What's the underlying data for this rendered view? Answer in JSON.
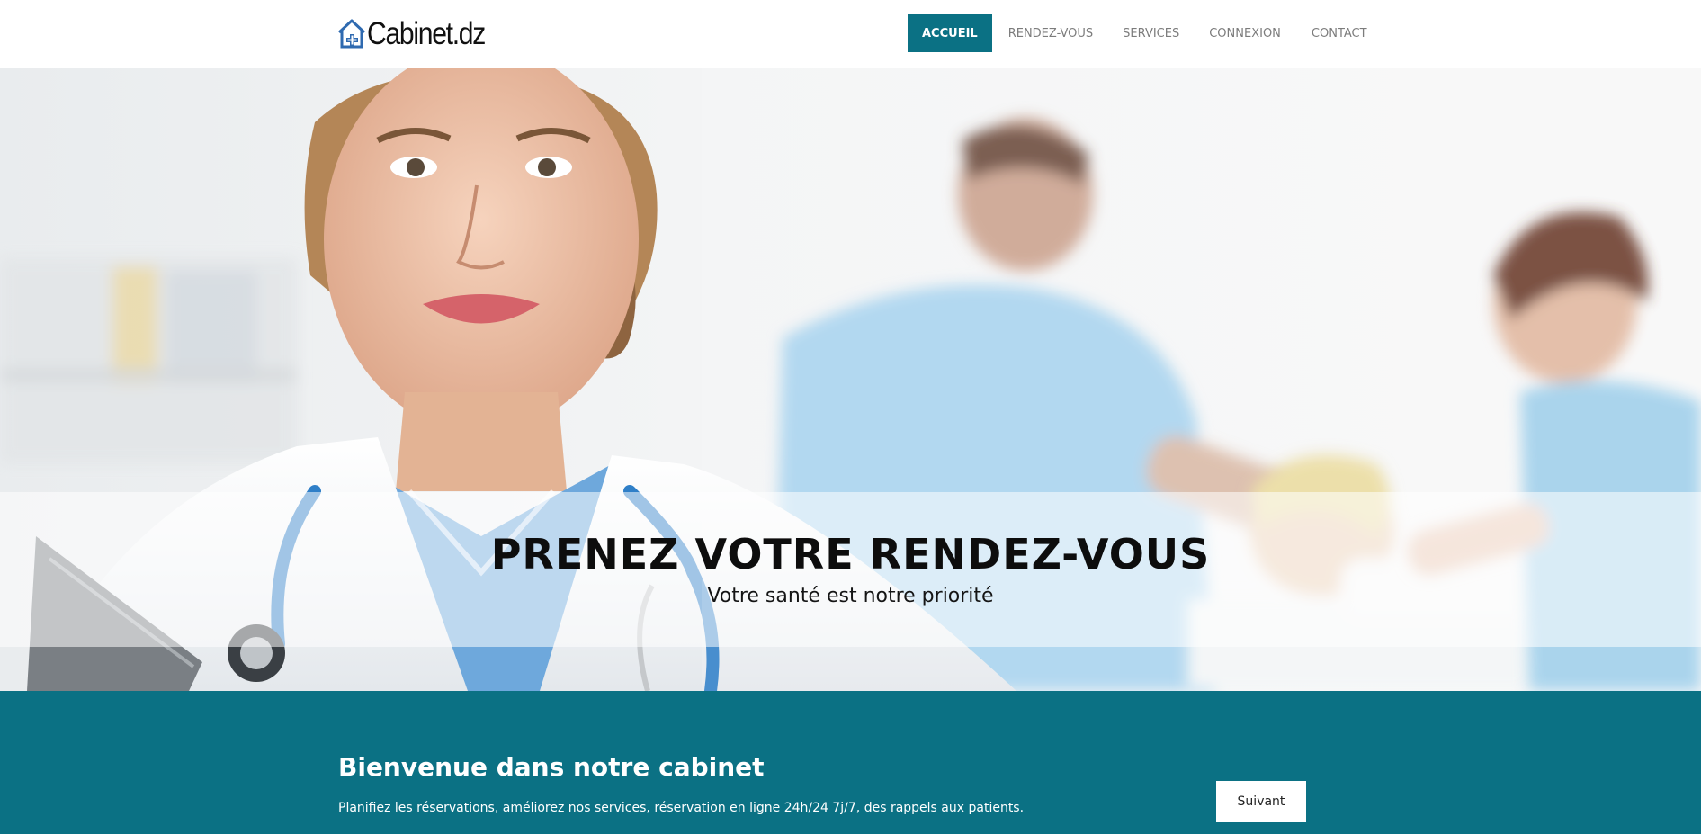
{
  "header": {
    "logo_text": "Cabinet.dz",
    "logo_icon": "house-medical-cross-icon",
    "nav": [
      {
        "label": "ACCUEIL",
        "active": true
      },
      {
        "label": "RENDEZ-VOUS",
        "active": false
      },
      {
        "label": "SERVICES",
        "active": false
      },
      {
        "label": "CONNEXION",
        "active": false
      },
      {
        "label": "CONTACT",
        "active": false
      }
    ]
  },
  "hero": {
    "title": "PRENEZ VOTRE RENDEZ-VOUS",
    "subtitle": "Votre santé est notre priorité"
  },
  "welcome": {
    "title": "Bienvenue dans notre cabinet",
    "text": "Planifiez les réservations, améliorez nos services, réservation en ligne 24h/24 7j/7, des rappels aux patients.",
    "button_label": "Suivant"
  },
  "colors": {
    "accent": "#0b7184",
    "logo_blue": "#2f6ab0"
  }
}
